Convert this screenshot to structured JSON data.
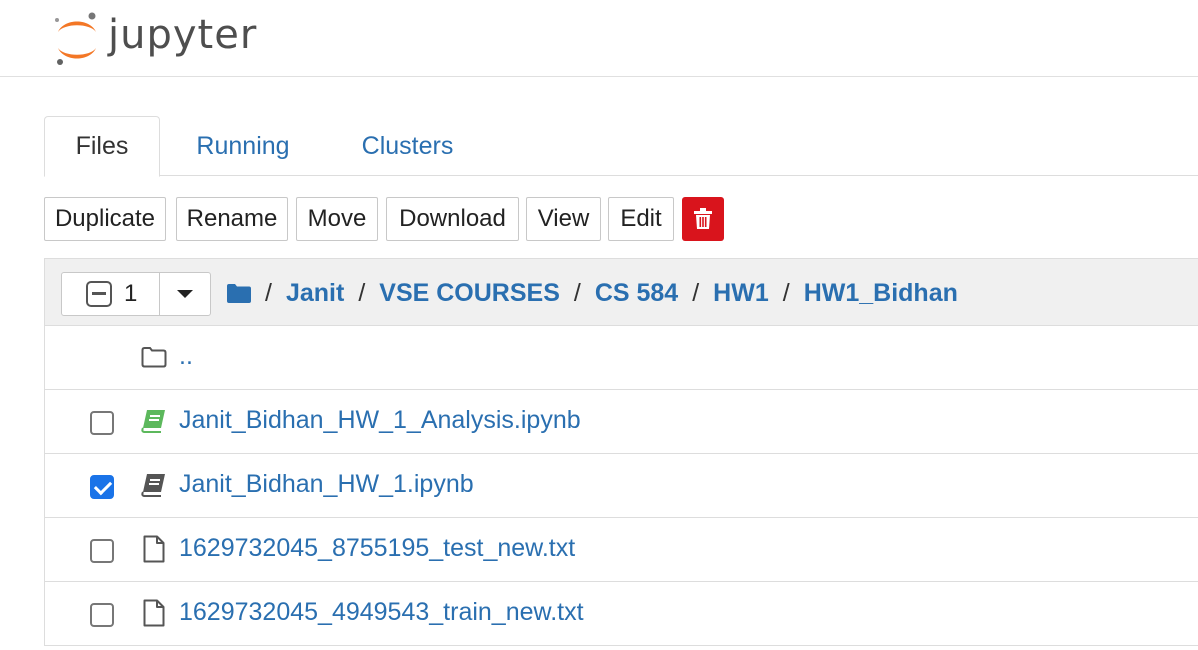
{
  "app": {
    "logo_text": "jupyter"
  },
  "tabs": [
    {
      "label": "Files",
      "active": true
    },
    {
      "label": "Running",
      "active": false
    },
    {
      "label": "Clusters",
      "active": false
    }
  ],
  "toolbar": {
    "duplicate": "Duplicate",
    "rename": "Rename",
    "move": "Move",
    "download": "Download",
    "view": "View",
    "edit": "Edit",
    "delete_icon": "trash-icon",
    "delete_color": "#d9141c"
  },
  "listing": {
    "selected_count": "1",
    "breadcrumb": {
      "home_icon": "folder-icon",
      "separator": "/",
      "items": [
        "Janit",
        "VSE COURSES",
        "CS 584",
        "HW1",
        "HW1_Bidhan"
      ]
    },
    "parent": {
      "label": ".."
    },
    "files": [
      {
        "name": "Janit_Bidhan_HW_1_Analysis.ipynb",
        "icon": "notebook-running-icon",
        "checked": false
      },
      {
        "name": "Janit_Bidhan_HW_1.ipynb",
        "icon": "notebook-icon",
        "checked": true
      },
      {
        "name": "1629732045_8755195_test_new.txt",
        "icon": "file-icon",
        "checked": false
      },
      {
        "name": "1629732045_4949543_train_new.txt",
        "icon": "file-icon",
        "checked": false
      }
    ]
  },
  "colors": {
    "link": "#2a6fb0",
    "notebook_running": "#5cb85c",
    "checkbox_checked": "#1a73e8"
  }
}
